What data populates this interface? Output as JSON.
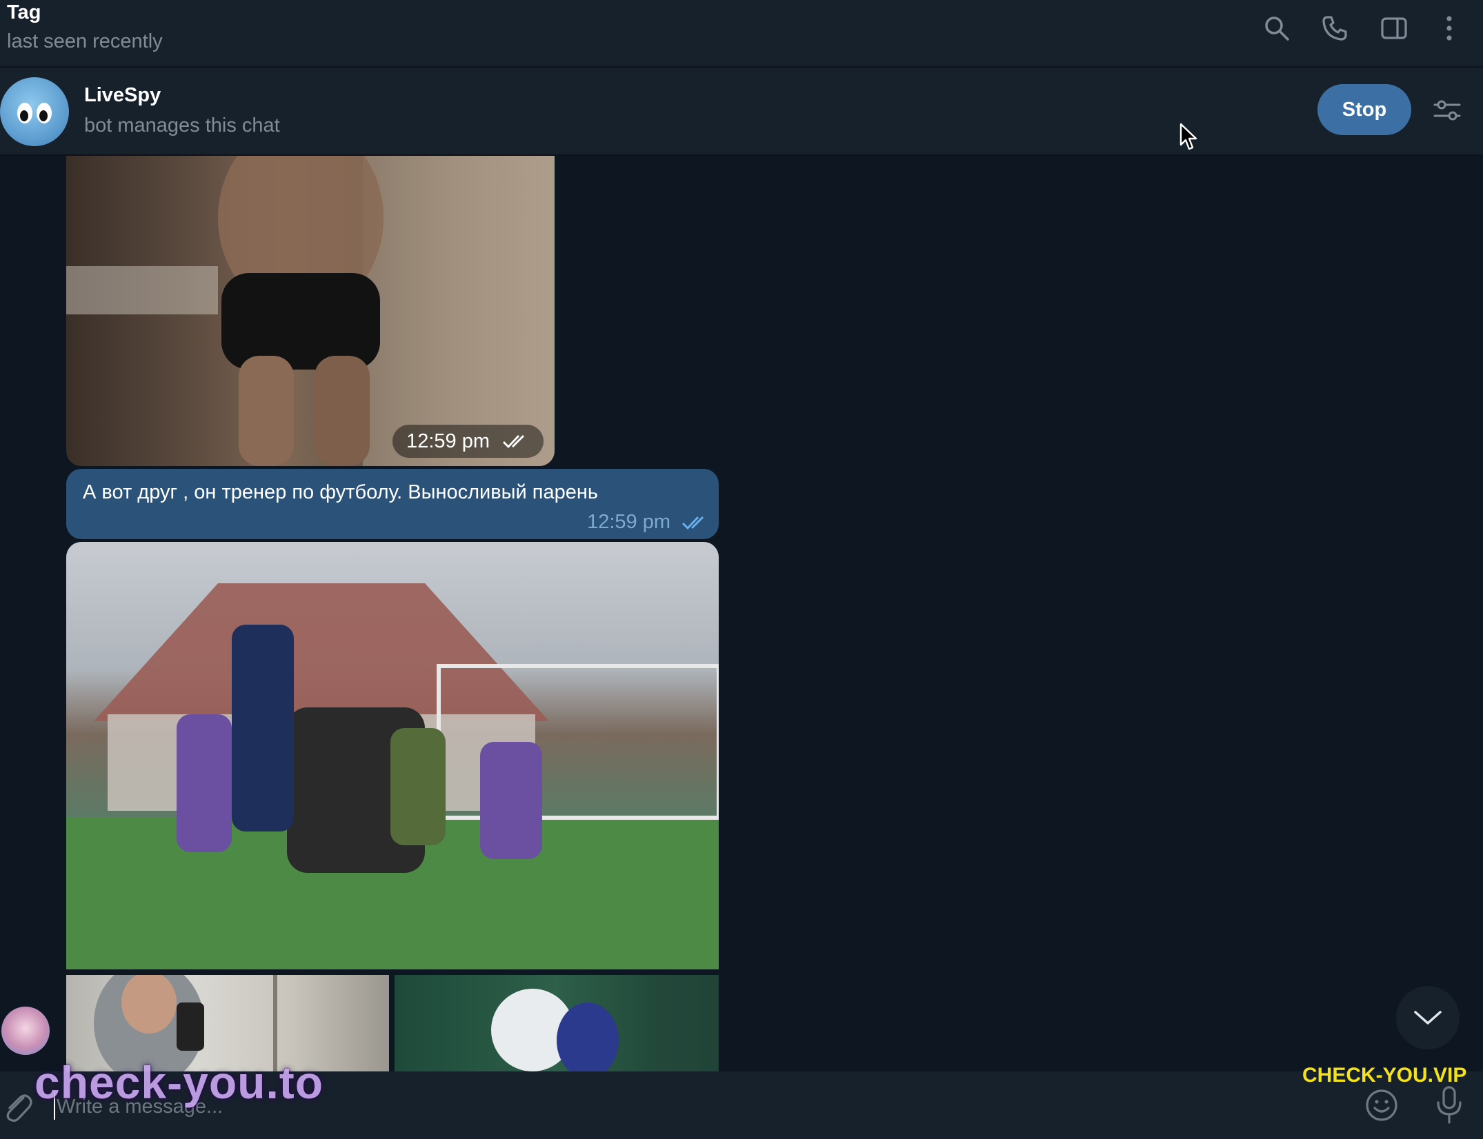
{
  "header": {
    "title": "Tag",
    "status": "last seen recently",
    "icons": [
      "search-icon",
      "phone-icon",
      "sidebar-toggle-icon",
      "more-vertical-icon"
    ]
  },
  "bot_bar": {
    "name": "LiveSpy",
    "description": "bot manages this chat",
    "stop_label": "Stop",
    "settings_icon": "settings-sliders-icon"
  },
  "messages": [
    {
      "type": "photo",
      "time": "12:59 pm",
      "status": "read"
    },
    {
      "type": "text",
      "text": "А вот друг , он тренер по футболу. Выносливый парень",
      "time": "12:59 pm",
      "status": "read"
    },
    {
      "type": "photo",
      "status": "read"
    },
    {
      "type": "photo-album",
      "count": 2
    }
  ],
  "composer": {
    "placeholder": "Write a message...",
    "attach_icon": "paperclip-icon",
    "emoji_icon": "emoji-icon",
    "mic_icon": "microphone-icon"
  },
  "watermarks": {
    "left": "check-you.to",
    "right": "CHECK-YOU.VIP"
  },
  "colors": {
    "background": "#0e1621",
    "panel": "#17212b",
    "outgoing_bubble": "#2b5278",
    "accent_button": "#3c6fa4",
    "read_check": "#6ab2f2"
  }
}
